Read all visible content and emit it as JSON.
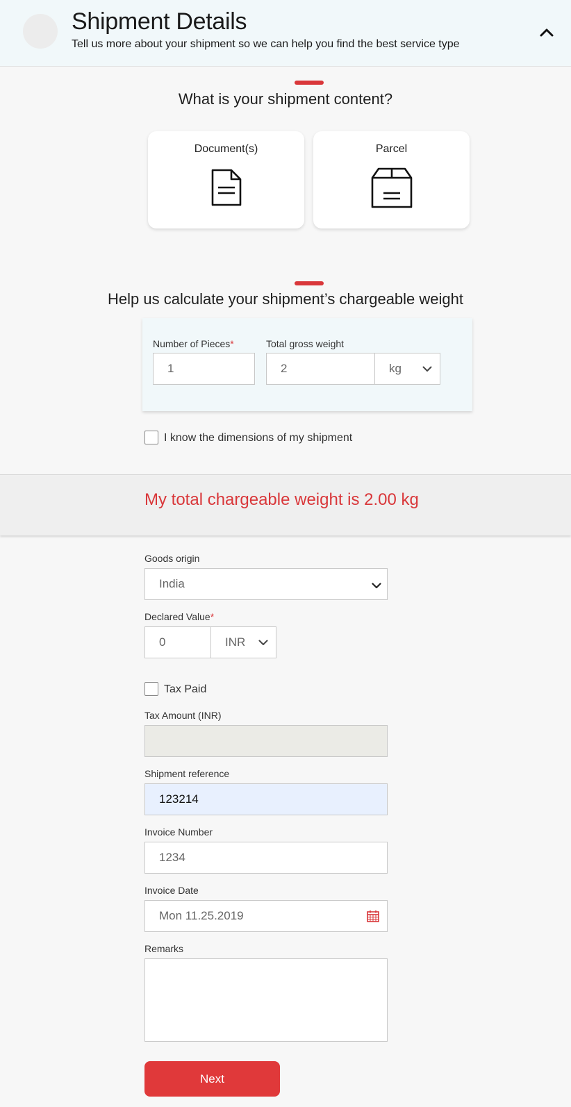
{
  "header": {
    "title": "Shipment Details",
    "subtitle": "Tell us more about your shipment so we can help you find the best service type"
  },
  "content_section": {
    "title": "What is your shipment content?",
    "options": [
      {
        "label": "Document(s)",
        "icon": "document-icon"
      },
      {
        "label": "Parcel",
        "icon": "parcel-box-icon"
      }
    ]
  },
  "weight_section": {
    "title": "Help us calculate your shipment’s chargeable weight",
    "pieces_label": "Number of Pieces",
    "pieces_value": "1",
    "gross_weight_label": "Total gross weight",
    "gross_weight_value": "2",
    "unit_value": "kg",
    "required_mark": "*",
    "dimensions_checkbox_label": "I know the dimensions of my shipment"
  },
  "chargeable": {
    "text": "My total chargeable weight is 2.00 kg"
  },
  "form": {
    "goods_origin_label": "Goods origin",
    "goods_origin_value": "India",
    "declared_value_label": "Declared Value",
    "declared_value": "0",
    "currency": "INR",
    "tax_paid_label": "Tax Paid",
    "tax_amount_label": "Tax Amount (INR)",
    "tax_amount_value": "",
    "shipment_reference_label": "Shipment reference",
    "shipment_reference_value": "123214",
    "invoice_number_label": "Invoice Number",
    "invoice_number_value": "1234",
    "invoice_date_label": "Invoice Date",
    "invoice_date_value": "Mon 11.25.2019",
    "remarks_label": "Remarks",
    "remarks_value": "",
    "next_label": "Next"
  },
  "colors": {
    "accent_red": "#d9373a",
    "header_bg": "#f1f8fa",
    "autofill_bg": "#e8f0fe",
    "disabled_bg": "#ebebe6"
  }
}
